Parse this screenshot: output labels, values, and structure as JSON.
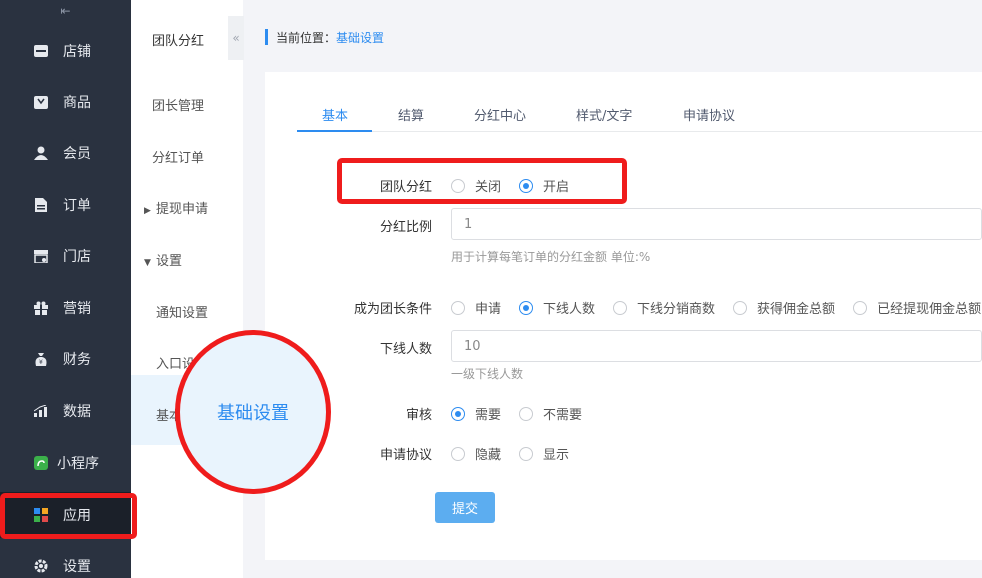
{
  "sidebar": {
    "collapse_glyph": "⇤",
    "items": [
      {
        "label": "店铺",
        "icon": "store-icon"
      },
      {
        "label": "商品",
        "icon": "goods-icon"
      },
      {
        "label": "会员",
        "icon": "member-icon"
      },
      {
        "label": "订单",
        "icon": "order-icon"
      },
      {
        "label": "门店",
        "icon": "shop-icon"
      },
      {
        "label": "营销",
        "icon": "gift-icon"
      },
      {
        "label": "财务",
        "icon": "money-bag-icon"
      },
      {
        "label": "数据",
        "icon": "chart-icon"
      },
      {
        "label": "小程序",
        "icon": "miniprogram-icon"
      },
      {
        "label": "应用",
        "icon": "apps-icon"
      },
      {
        "label": "设置",
        "icon": "gear-icon"
      }
    ],
    "active": "应用"
  },
  "subnav": {
    "title": "团队分红",
    "items": [
      "团长管理",
      "分红订单",
      "提现申请",
      "设置",
      "通知设置",
      "入口设",
      "基本"
    ],
    "collapse_glyph": "«"
  },
  "breadcrumb": {
    "prefix": "当前位置：",
    "current": "基础设置"
  },
  "tabs": [
    "基本",
    "结算",
    "分红中心",
    "样式/文字",
    "申请协议"
  ],
  "form": {
    "team_bonus": {
      "label": "团队分红",
      "options": [
        "关闭",
        "开启"
      ],
      "selected": "开启"
    },
    "bonus_ratio": {
      "label": "分红比例",
      "placeholder": "1",
      "hint": "用于计算每笔订单的分红金额 单位:%"
    },
    "leader_condition": {
      "label": "成为团长条件",
      "options": [
        "申请",
        "下线人数",
        "下线分销商数",
        "获得佣金总额",
        "已经提现佣金总额"
      ],
      "selected": "下线人数"
    },
    "downline_count": {
      "label": "下线人数",
      "placeholder": "10",
      "hint": "一级下线人数"
    },
    "review": {
      "label": "审核",
      "options": [
        "需要",
        "不需要"
      ],
      "selected": "需要"
    },
    "agreement": {
      "label": "申请协议",
      "options": [
        "隐藏",
        "显示"
      ],
      "selected": ""
    },
    "submit_label": "提交"
  },
  "callout": {
    "label": "基础设置"
  },
  "colors": {
    "accent": "#2d8cf0",
    "sidebar_bg": "#2a3240",
    "highlight": "#ef1c1c"
  }
}
